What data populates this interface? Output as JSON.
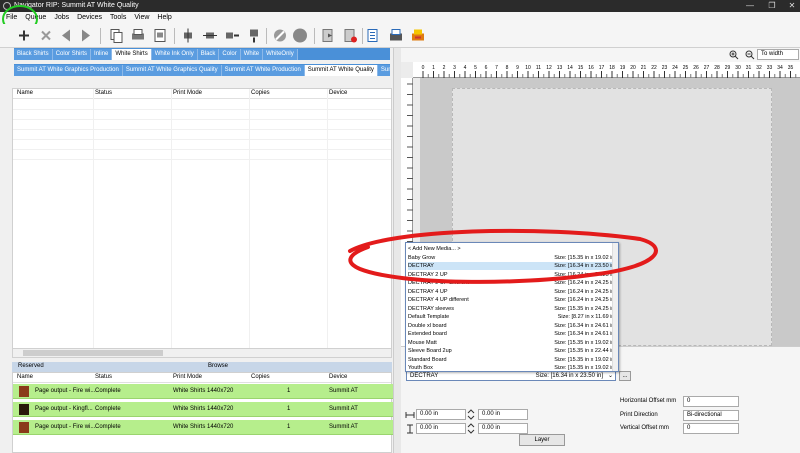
{
  "window": {
    "title": "Navigator RIP: Summit AT White Quality"
  },
  "menu": [
    "File",
    "Queue",
    "Jobs",
    "Devices",
    "Tools",
    "View",
    "Help"
  ],
  "tabs_row1": [
    "Black Shirts",
    "Color Shirts",
    "Inline",
    "White Shirts",
    "White Ink Only",
    "Black",
    "Color",
    "White",
    "WhiteOnly"
  ],
  "tabs_row1_active": "White Shirts",
  "tabs_row2": [
    "Summit AT White Graphics Production",
    "Summit AT White Graphics Quality",
    "Summit AT White Production",
    "Summit AT White Quality",
    "Summit"
  ],
  "tabs_row2_active": "Summit AT White Quality",
  "job_table": {
    "columns": [
      "Name",
      "Status",
      "Print Mode",
      "Copies",
      "Device"
    ]
  },
  "lower_tabs": {
    "reserved": "Reserved",
    "browse": "Browse"
  },
  "lower_table": {
    "columns": [
      "Name",
      "Status",
      "Print Mode",
      "Copies",
      "Device"
    ],
    "rows": [
      {
        "name": "Page output - Fire wi...",
        "status": "Complete",
        "mode": "White Shirts 1440x720",
        "copies": "1",
        "device": "Summit AT"
      },
      {
        "name": "Page output - Kingfl...",
        "status": "Complete",
        "mode": "White Shirts 1440x720",
        "copies": "1",
        "device": "Summit AT"
      },
      {
        "name": "Page output - Fire wi...",
        "status": "Complete",
        "mode": "White Shirts 1440x720",
        "copies": "1",
        "device": "Summit AT"
      }
    ]
  },
  "zoom": {
    "value": "To width"
  },
  "ruler_labels": [
    "0",
    "1",
    "2",
    "3",
    "4",
    "5",
    "6",
    "7",
    "8",
    "9",
    "10",
    "11",
    "12",
    "13",
    "14",
    "15",
    "16",
    "17",
    "18",
    "19",
    "20",
    "21",
    "22",
    "23",
    "24",
    "25",
    "26",
    "27",
    "28",
    "29",
    "30",
    "31",
    "32",
    "33",
    "34",
    "35"
  ],
  "media_dropdown": {
    "items": [
      {
        "name": "< Add New Media... >",
        "size": ""
      },
      {
        "name": "Baby Grow",
        "size": "Size: [15.35 in x 19.02 in]"
      },
      {
        "name": "DECTRAY",
        "size": "Size: [16.34 in x 23.50 in]"
      },
      {
        "name": "DECTRAY 2 UP",
        "size": "Size: [16.24 in x 24.25 in]"
      },
      {
        "name": "DECTRAY 2 UP different",
        "size": "Size: [16.24 in x 24.25 in]"
      },
      {
        "name": "DECTRAY 4 UP",
        "size": "Size: [16.24 in x 24.25 in]"
      },
      {
        "name": "DECTRAY 4 UP different",
        "size": "Size: [16.24 in x 24.25 in]"
      },
      {
        "name": "DECTRAY sleeves",
        "size": "Size: [15.35 in x 24.25 in]"
      },
      {
        "name": "Default Template",
        "size": "Size: [8.27 in x 11.69 in]"
      },
      {
        "name": "Double xl board",
        "size": "Size: [16.34 in x 24.61 in]"
      },
      {
        "name": "Extended board",
        "size": "Size: [16.34 in x 24.61 in]"
      },
      {
        "name": "Mouse Matt",
        "size": "Size: [15.35 in x 19.02 in]"
      },
      {
        "name": "Sleeve Board 2up",
        "size": "Size: [15.35 in x 22.44 in]"
      },
      {
        "name": "Standard Board",
        "size": "Size: [15.35 in x 19.02 in]"
      },
      {
        "name": "Youth Box",
        "size": "Size: [15.35 in x 19.02 in]"
      }
    ],
    "selected": "DECTRAY",
    "combo_name": "DECTRAY",
    "combo_size": "Size: [16.34 in x 23.50 in]",
    "more_button": "..."
  },
  "settings": {
    "offset_x1": "0.00 in",
    "offset_y1": "0.00 in",
    "offset_x2": "0.00 in",
    "offset_y2": "0.00 in",
    "h_offset_label": "Horizontal Offset mm",
    "h_offset_value": "0",
    "print_dir_label": "Print Direction",
    "print_dir_value": "Bi-directional",
    "v_offset_label": "Vertical Offset mm",
    "v_offset_value": "0",
    "layer_button": "Layer"
  },
  "colors": {
    "annotation": "#e31b1b",
    "highlight_circle": "#22cc22",
    "tab_blue": "#4a90d8",
    "row_green": "#b6ee8c"
  }
}
